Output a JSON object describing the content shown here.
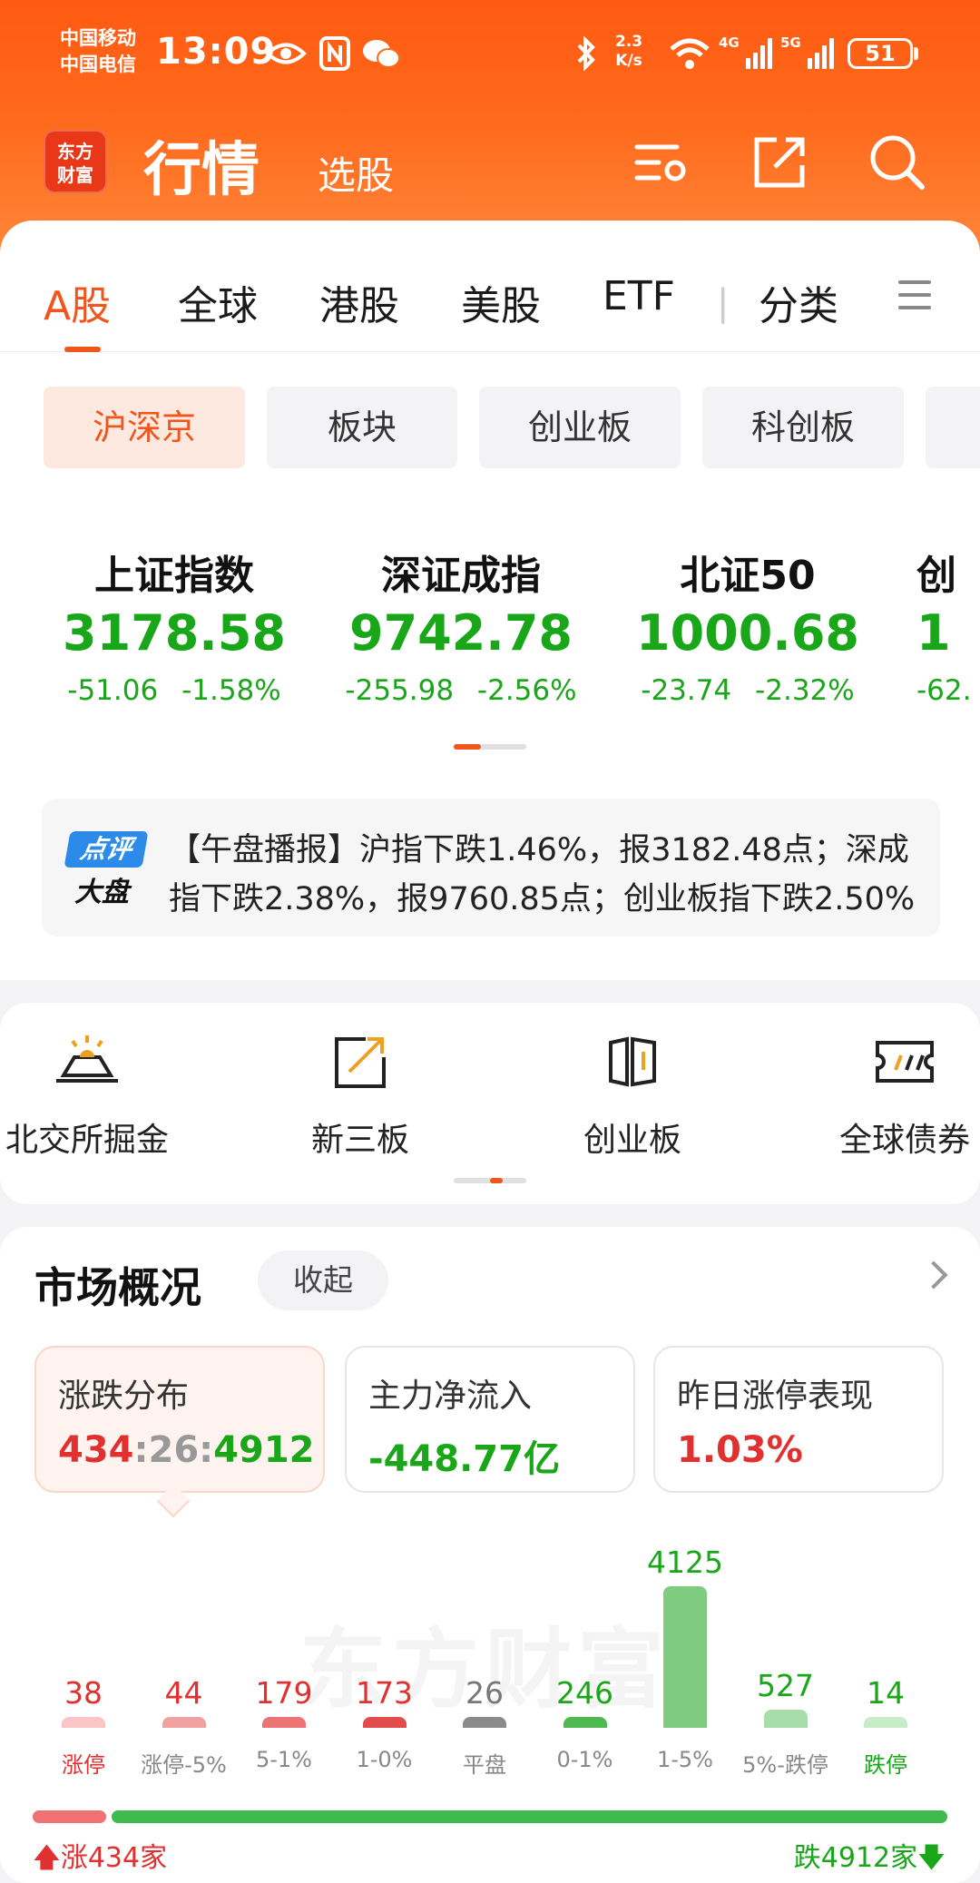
{
  "status_bar": {
    "carrier_1": "中国移动",
    "carrier_2": "中国电信",
    "time": "13:09",
    "net_speed_value": "2.3",
    "net_speed_unit": "K/s",
    "signal_1": "4G",
    "signal_2": "5G",
    "battery": "51"
  },
  "app_header": {
    "logo_line1": "东方",
    "logo_line2": "财富",
    "title": "行情",
    "subtitle": "选股"
  },
  "market_tabs": [
    "A股",
    "全球",
    "港股",
    "美股",
    "ETF",
    "分类"
  ],
  "sub_tabs": [
    "沪深京",
    "板块",
    "创业板",
    "科创板"
  ],
  "indices": [
    {
      "name": "上证指数",
      "value": "3178.58",
      "change": "-51.06",
      "pct": "-1.58%"
    },
    {
      "name": "深证成指",
      "value": "9742.78",
      "change": "-255.98",
      "pct": "-2.56%"
    },
    {
      "name": "北证50",
      "value": "1000.68",
      "change": "-23.74",
      "pct": "-2.32%"
    },
    {
      "name": "创",
      "value": "1",
      "change": "-62.",
      "pct": ""
    }
  ],
  "news": {
    "badge_top": "点评",
    "badge_bottom": "大盘",
    "text": "【午盘播报】沪指下跌1.46%，报3182.48点；深成指下跌2.38%，报9760.85点；创业板指下跌2.50%"
  },
  "quick_entries": [
    "北交所掘金",
    "新三板",
    "创业板",
    "全球债券"
  ],
  "market_overview": {
    "title": "市场概况",
    "collapse_label": "收起",
    "watermark": "东方财富",
    "stats": [
      {
        "label": "涨跌分布",
        "up": "434",
        "flat": "26",
        "down": "4912"
      },
      {
        "label": "主力净流入",
        "value": "-448.77亿"
      },
      {
        "label": "昨日涨停表现",
        "value": "1.03%"
      }
    ],
    "up_count_text": "涨434家",
    "down_count_text": "跌4912家"
  },
  "chart_data": {
    "type": "bar",
    "categories": [
      "涨停",
      "涨停-5%",
      "5-1%",
      "1-0%",
      "平盘",
      "0-1%",
      "1-5%",
      "5%-跌停",
      "跌停"
    ],
    "values": [
      38,
      44,
      179,
      173,
      26,
      246,
      4125,
      527,
      14
    ],
    "colors": [
      "#f9c5c5",
      "#f2a1a1",
      "#ec7474",
      "#e14c4c",
      "#8a8a8a",
      "#4fb84f",
      "#7fcb7f",
      "#a8dca8",
      "#c8ebc8"
    ],
    "up_total": 434,
    "flat_total": 26,
    "down_total": 4912
  }
}
